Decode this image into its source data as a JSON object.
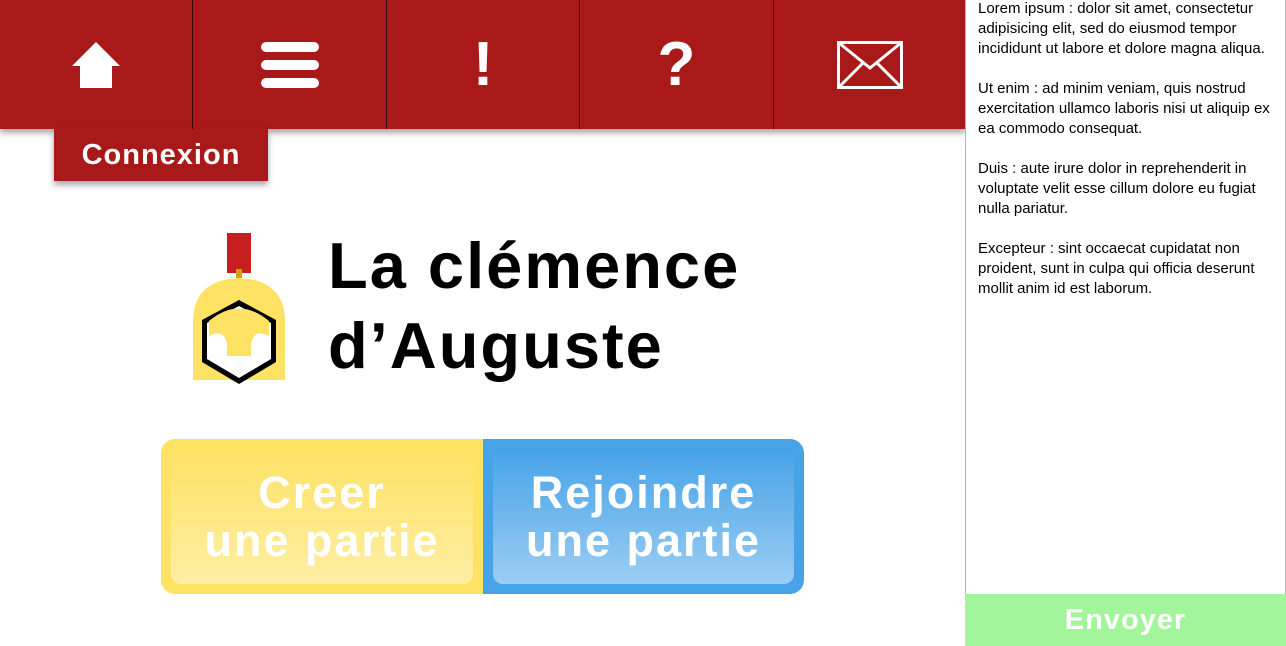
{
  "nav": {
    "home_icon": "home-icon",
    "menu_icon": "menu-icon",
    "alert_icon": "exclamation-icon",
    "alert_glyph": "!",
    "help_icon": "question-icon",
    "help_glyph": "?",
    "mail_icon": "envelope-icon",
    "background": "#a91919"
  },
  "connexion_label": "Connexion",
  "title": {
    "line1": "La clémence",
    "line2": "d’Auguste"
  },
  "actions": {
    "create": {
      "line1": "Creer",
      "line2": "une partie",
      "color": "#fde264"
    },
    "join": {
      "line1": "Rejoindre",
      "line2": "une partie",
      "color": "#46a3e8"
    }
  },
  "chat": {
    "messages": [
      "Lorem ipsum : dolor sit amet, consectetur adipisicing elit, sed do eiusmod tempor incididunt ut labore et dolore magna aliqua.",
      "Ut enim : ad minim veniam, quis nostrud exercitation ullamco laboris nisi ut aliquip ex ea commodo consequat.",
      "Duis : aute irure dolor in reprehenderit in voluptate velit esse cillum dolore eu fugiat nulla pariatur.",
      "Excepteur : sint occaecat cupidatat non proident, sunt in culpa qui officia deserunt mollit anim id est laborum."
    ],
    "send_label": "Envoyer",
    "send_color": "#a3f59b"
  }
}
